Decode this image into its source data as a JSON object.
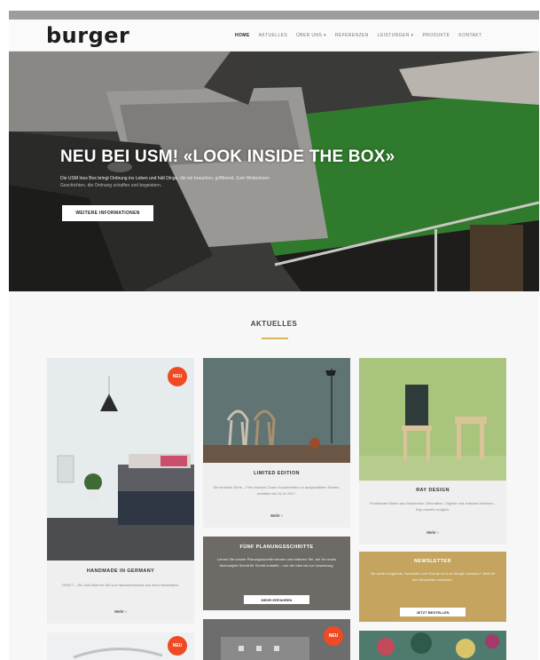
{
  "header": {
    "logo": "burger",
    "nav": [
      "HOME",
      "AKTUELLES",
      "ÜBER UNS ▾",
      "REFERENZEN",
      "LEISTUNGEN ▾",
      "PRODUKTE",
      "KONTAKT"
    ]
  },
  "hero": {
    "headline": "NEU BEI USM! «LOOK INSIDE THE BOX»",
    "text_line1": "Die USM Inos Box bringt Ordnung ins Leben und hält Dinge, die wir brauchen, griffbereit. Zum Weiterlesen",
    "text_line2": "Geschichten, die Ordnung schaffen und begeistern.",
    "cta": "WEITERE INFORMATIONEN",
    "slides": 3,
    "active_slide": 1
  },
  "section": {
    "title": "AKTUELLES"
  },
  "cards": [
    {
      "title": "HANDMADE IN GERMANY",
      "text": "DRAFT – Ein Sofa Bett mit Stil und Handwerkskunst aus einer Manufaktur.",
      "more": "Mehr ›",
      "badge": "NEU"
    },
    {
      "title": "LIMITED EDITION",
      "text": "Die limitierte Serie – Fritz Hansen Chairs Sonderedition in ausgewählten Farben, erhältlich bis 31.01.2017.",
      "more": "Mehr ›"
    },
    {
      "title": "RAY DESIGN",
      "text": "Funktionale Möbel aus Massivholz, Dekoration, Objekte und zeitloses Wohnen – Ray macht's möglich.",
      "more": "Mehr ›"
    },
    {
      "title": "FÜNF PLANUNGSSCHRITTE",
      "text": "Lernen Sie unsere Planungsschritte kennen und erfahren Sie, wie Ihr neues Wohnobjekt Schritt für Schritt entsteht – von der Idee bis zur Umsetzung.",
      "button": "MEHR ERFAHREN"
    },
    {
      "title": "NEWSLETTER",
      "text": "Sie wollen Angebote, Neuheiten und Events rund um Burger erfahren? Jetzt für den Newsletter anmelden.",
      "button": "JETZT BESTELLEN"
    },
    {
      "badge": "NEU"
    },
    {
      "badge": "NEU"
    },
    {}
  ],
  "colors": {
    "accent": "#d9b65a",
    "badge": "#ef4a23",
    "dark_card": "#6e6a66",
    "gold_card": "#c4a45e"
  }
}
